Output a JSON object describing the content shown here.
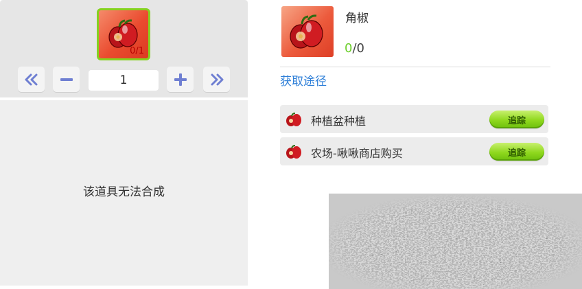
{
  "left": {
    "slot_count": "0/1",
    "quantity": "1",
    "message": "该道具无法合成"
  },
  "item": {
    "name": "角椒",
    "owned": "0",
    "sep_total": "/0",
    "image": "red-pepper-icon"
  },
  "sources": {
    "title": "获取途径",
    "rows": [
      {
        "label": "种植盆种植",
        "button": "追踪",
        "icon": "red-pepper-icon"
      },
      {
        "label": "农场-啾啾商店购买",
        "button": "追踪",
        "icon": "red-pepper-icon"
      }
    ]
  },
  "colors": {
    "slot_border": "#86d11f",
    "slot_bg": "#ea4b2f",
    "owned_green": "#6ccf2b",
    "link_blue": "#2e7fd8",
    "button_green": "#8fd81e"
  }
}
